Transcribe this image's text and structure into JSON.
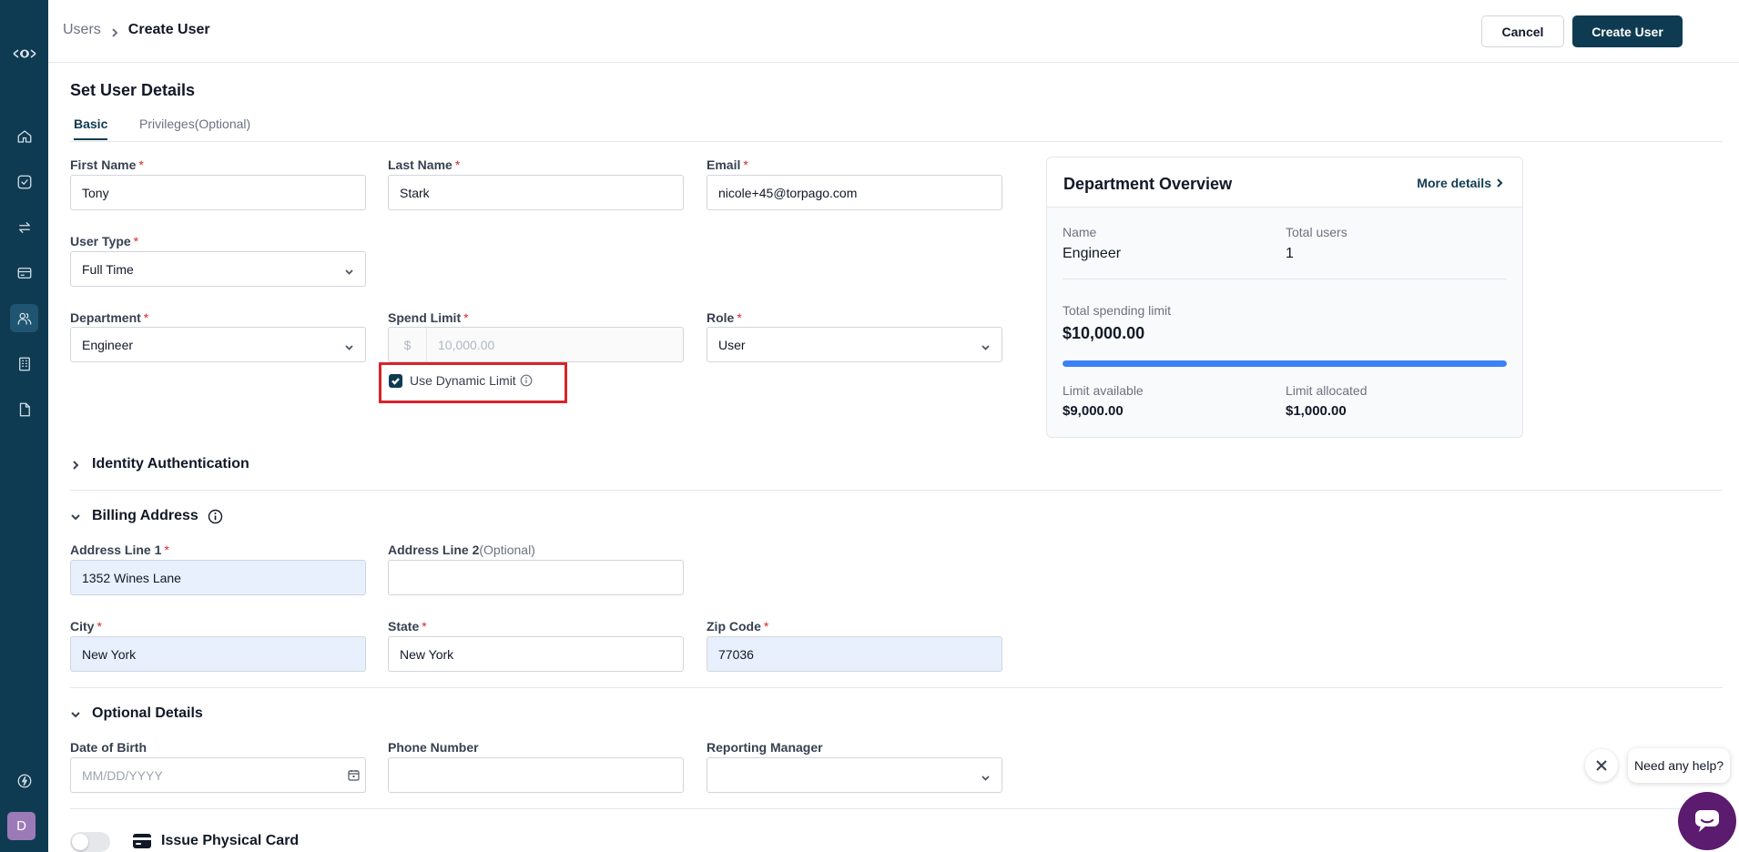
{
  "breadcrumb": {
    "parent": "Users",
    "current": "Create User"
  },
  "header": {
    "cancel_label": "Cancel",
    "create_label": "Create User"
  },
  "page": {
    "title": "Set User Details"
  },
  "tabs": [
    {
      "label": "Basic"
    },
    {
      "label": "Privileges(Optional)"
    }
  ],
  "basic": {
    "first_name": {
      "label": "First Name",
      "value": "Tony"
    },
    "last_name": {
      "label": "Last Name",
      "value": "Stark"
    },
    "email": {
      "label": "Email",
      "value": "nicole+45@torpago.com"
    },
    "user_type": {
      "label": "User Type",
      "value": "Full Time"
    },
    "department": {
      "label": "Department",
      "value": "Engineer"
    },
    "spend_limit": {
      "label": "Spend Limit",
      "currency": "$",
      "placeholder": "10,000.00"
    },
    "role": {
      "label": "Role",
      "value": "User"
    },
    "dynamic_limit": {
      "label": "Use Dynamic Limit",
      "checked": true
    }
  },
  "department_overview": {
    "title": "Department Overview",
    "more_label": "More details",
    "name_label": "Name",
    "name_value": "Engineer",
    "users_label": "Total users",
    "users_value": "1",
    "spending_label": "Total spending limit",
    "spending_value": "$10,000.00",
    "progress_percent": 100,
    "available_label": "Limit available",
    "available_value": "$9,000.00",
    "allocated_label": "Limit allocated",
    "allocated_value": "$1,000.00"
  },
  "identity": {
    "title": "Identity Authentication"
  },
  "billing": {
    "title": "Billing Address",
    "address1": {
      "label": "Address Line 1",
      "value": "1352 Wines Lane"
    },
    "address2": {
      "label": "Address Line 2",
      "optional": "(Optional)",
      "value": ""
    },
    "city": {
      "label": "City",
      "value": "New York"
    },
    "state": {
      "label": "State",
      "value": "New York"
    },
    "zip": {
      "label": "Zip Code",
      "value": "77036"
    }
  },
  "optional": {
    "title": "Optional Details",
    "dob": {
      "label": "Date of Birth",
      "placeholder": "MM/DD/YYYY"
    },
    "phone": {
      "label": "Phone Number",
      "value": ""
    },
    "manager": {
      "label": "Reporting Manager",
      "value": ""
    }
  },
  "physical_card": {
    "label": "Issue Physical Card",
    "enabled": false
  },
  "help": {
    "bubble": "Need any help?"
  },
  "sidebar": {
    "avatar_letter": "D",
    "active_item": "users"
  },
  "required_mark": "*",
  "colors": {
    "primary": "#0f3b52",
    "accent": "#3b82f6",
    "highlight": "#d9232a",
    "chat": "#5b1b6e"
  }
}
